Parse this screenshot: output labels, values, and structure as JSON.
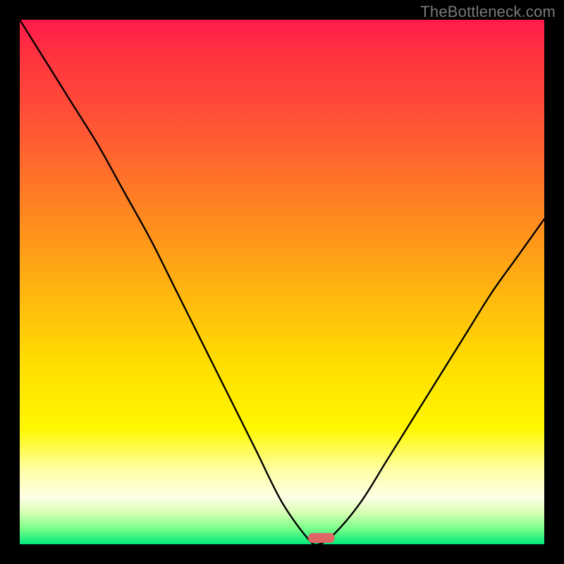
{
  "watermark": "TheBottleneck.com",
  "colors": {
    "background": "#000000",
    "curve": "#000000",
    "marker": "#e06666",
    "gradient_stops": [
      "#ff1a4d",
      "#ff3040",
      "#ff5a33",
      "#ff8a1f",
      "#ffb60f",
      "#ffdf00",
      "#fff700",
      "#ffffa8",
      "#ffffe6",
      "#d6ffb3",
      "#7aff8a",
      "#00e67a"
    ]
  },
  "chart_data": {
    "type": "line",
    "title": "",
    "xlabel": "",
    "ylabel": "",
    "xlim": [
      0,
      100
    ],
    "ylim": [
      0,
      100
    ],
    "x": [
      0,
      5,
      10,
      15,
      20,
      25,
      30,
      35,
      40,
      45,
      50,
      55,
      57,
      60,
      65,
      70,
      75,
      80,
      85,
      90,
      95,
      100
    ],
    "values": [
      100,
      92,
      84,
      76,
      67,
      58,
      48,
      38,
      28,
      18,
      8,
      1,
      0,
      2,
      8,
      16,
      24,
      32,
      40,
      48,
      55,
      62
    ],
    "marker": {
      "x_min": 55,
      "x_max": 60,
      "y": 0
    }
  }
}
